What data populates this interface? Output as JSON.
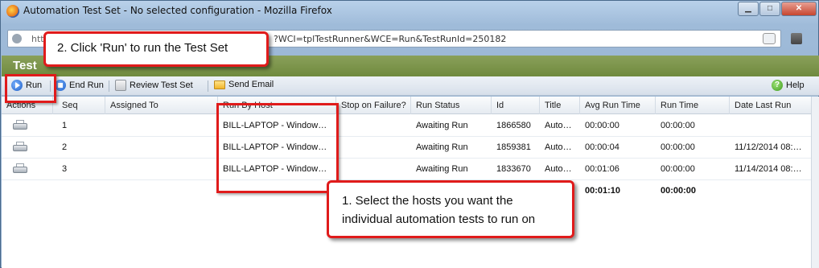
{
  "window": {
    "title": "Automation Test Set - No selected configuration - Mozilla Firefox",
    "minimize": "▁",
    "maximize": "□",
    "close": "✕"
  },
  "urlbar": {
    "prefix": "htt",
    "url": "?WCI=tplTestRunner&WCE=Run&TestRunId=250182"
  },
  "app": {
    "title": "Test"
  },
  "toolbar": {
    "run_label": "Run",
    "end_run_label": "End Run",
    "review_label": "Review Test Set",
    "email_label": "Send Email",
    "help_label": "Help"
  },
  "grid": {
    "columns": [
      "Actions",
      "Seq",
      "Assigned To",
      "Run By Host",
      "Stop on Failure?",
      "Run Status",
      "Id",
      "Title",
      "Avg Run Time",
      "Run Time",
      "Date Last Run"
    ],
    "rows": [
      {
        "seq": "1",
        "assigned": "",
        "host": "BILL-LAPTOP - Window…",
        "stop": "",
        "status": "Awaiting Run",
        "id": "1866580",
        "title": "Auto…",
        "avg": "00:00:00",
        "run": "00:00:00",
        "date": ""
      },
      {
        "seq": "2",
        "assigned": "",
        "host": "BILL-LAPTOP - Window…",
        "stop": "",
        "status": "Awaiting Run",
        "id": "1859381",
        "title": "Auto…",
        "avg": "00:00:04",
        "run": "00:00:00",
        "date": "11/12/2014 08:…"
      },
      {
        "seq": "3",
        "assigned": "",
        "host": "BILL-LAPTOP - Window…",
        "stop": "",
        "status": "Awaiting Run",
        "id": "1833670",
        "title": "Auto…",
        "avg": "00:01:06",
        "run": "00:00:00",
        "date": "11/14/2014 08:…"
      }
    ],
    "totals": {
      "avg": "00:01:10",
      "run": "00:00:00"
    }
  },
  "callouts": {
    "step2": "2. Click 'Run' to run the Test Set",
    "step1_line1": "1. Select the hosts you want the",
    "step1_line2": "individual automation tests to run on"
  },
  "colors": {
    "callout_border": "#e01b1b",
    "header_green": "#6f8a3e"
  }
}
